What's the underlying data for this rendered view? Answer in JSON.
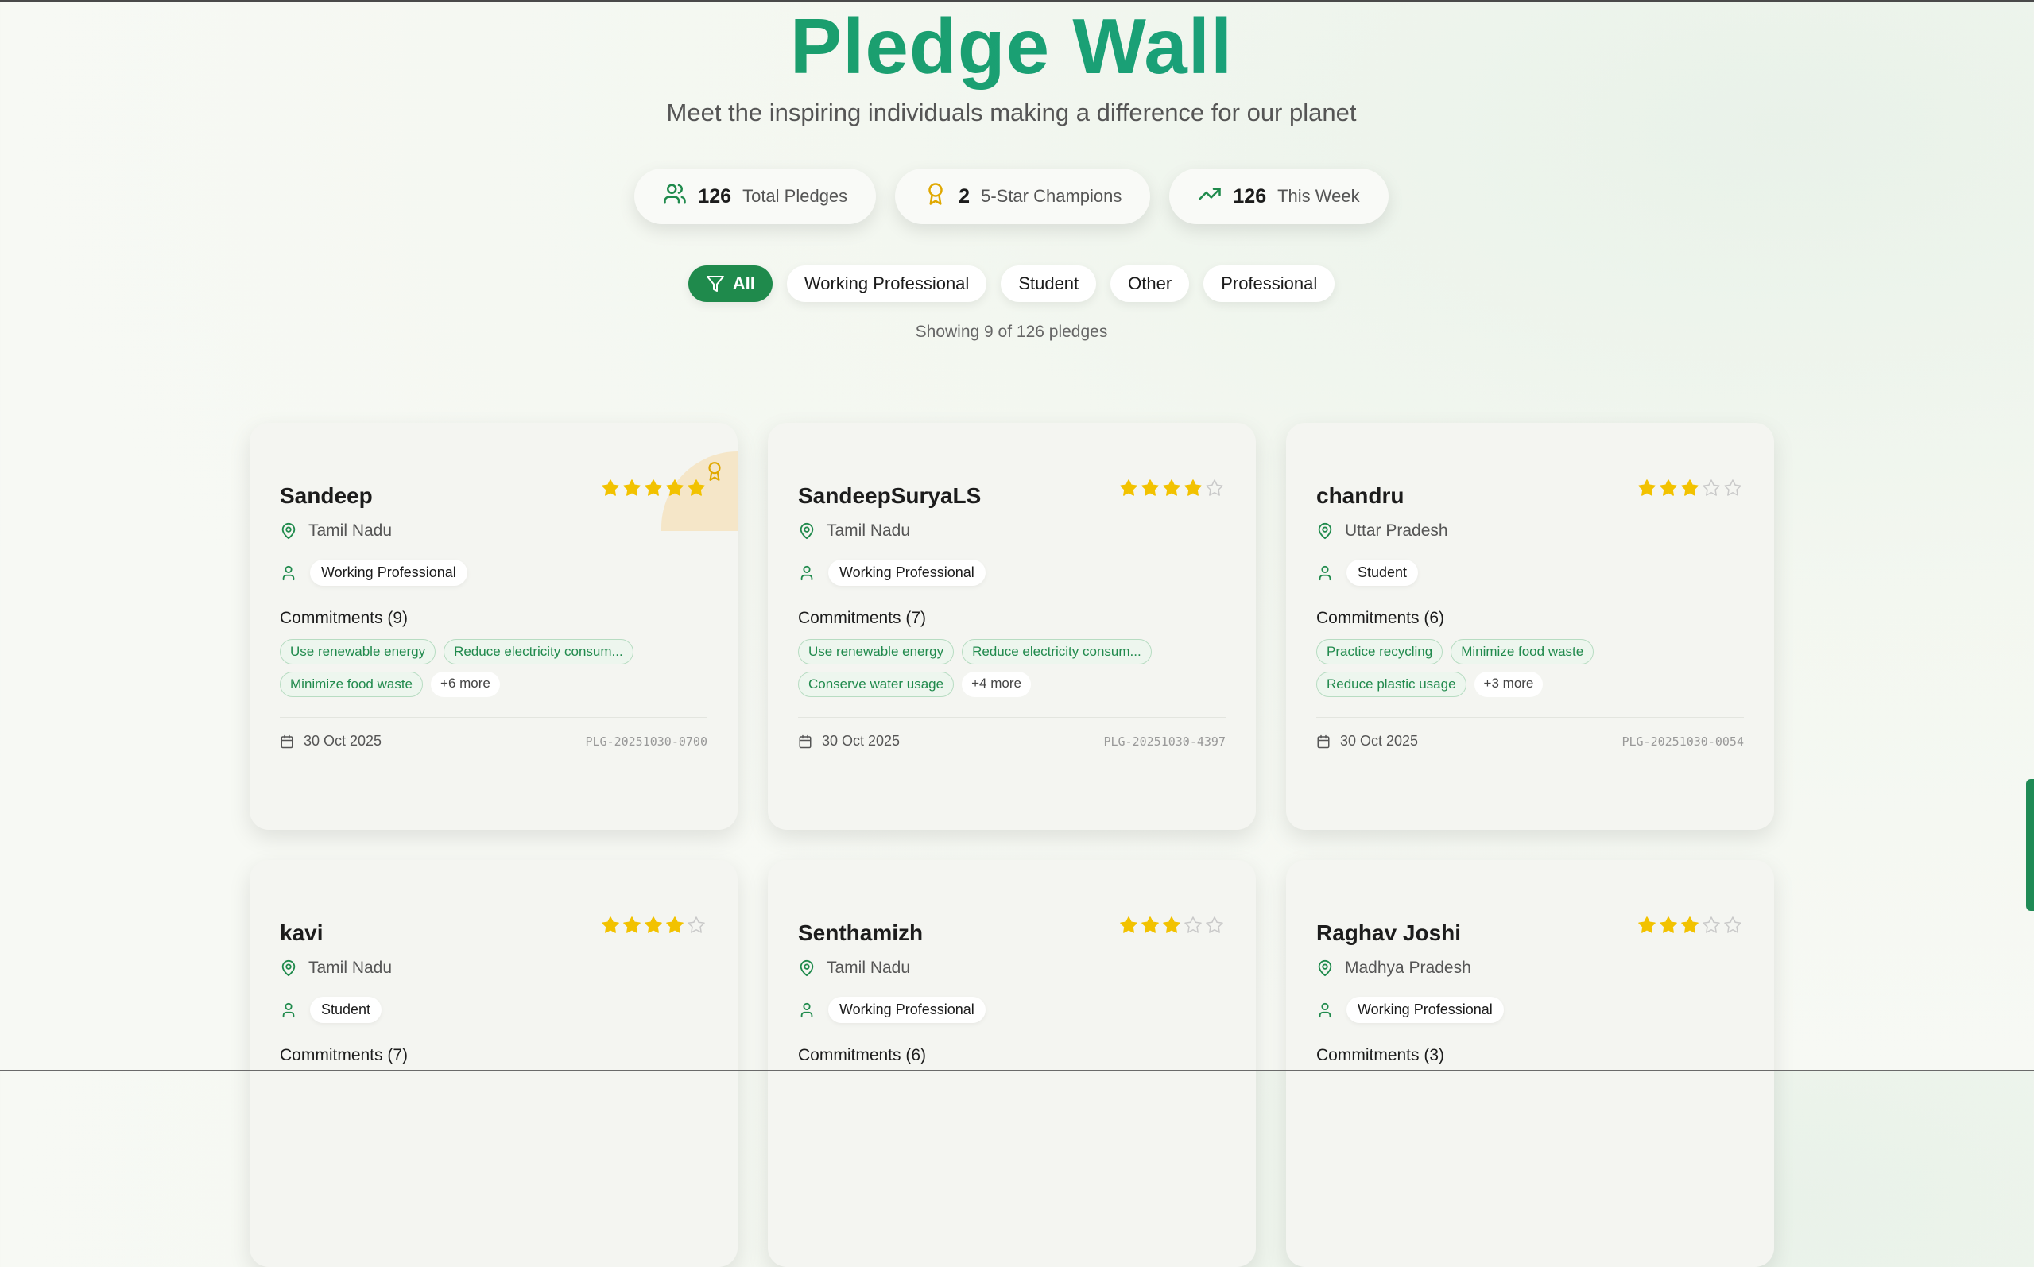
{
  "header": {
    "title": "Pledge Wall",
    "subtitle": "Meet the inspiring individuals making a difference for our planet"
  },
  "stats": [
    {
      "icon": "users-icon",
      "value": "126",
      "label": "Total Pledges"
    },
    {
      "icon": "award-icon",
      "value": "2",
      "label": "5-Star Champions"
    },
    {
      "icon": "trending-up-icon",
      "value": "126",
      "label": "This Week"
    }
  ],
  "filters": [
    {
      "label": "All",
      "active": true,
      "icon": "filter-icon"
    },
    {
      "label": "Working Professional",
      "active": false
    },
    {
      "label": "Student",
      "active": false
    },
    {
      "label": "Other",
      "active": false
    },
    {
      "label": "Professional",
      "active": false
    }
  ],
  "showing_text": "Showing 9 of 126 pledges",
  "colors": {
    "accent": "#1f8a4c",
    "star": "#f2c200",
    "star_empty": "#c9c9c9",
    "tag_text": "#218a4d"
  },
  "cards": [
    {
      "name": "Sandeep",
      "rating": 5,
      "champion": true,
      "location": "Tamil Nadu",
      "category": "Working Professional",
      "commitments_title": "Commitments (9)",
      "tags": [
        "Use renewable energy",
        "Reduce electricity consum...",
        "Minimize food waste"
      ],
      "more": "+6 more",
      "date": "30 Oct 2025",
      "pledge_id": "PLG-20251030-0700"
    },
    {
      "name": "SandeepSuryaLS",
      "rating": 4,
      "champion": false,
      "location": "Tamil Nadu",
      "category": "Working Professional",
      "commitments_title": "Commitments (7)",
      "tags": [
        "Use renewable energy",
        "Reduce electricity consum...",
        "Conserve water usage"
      ],
      "more": "+4 more",
      "date": "30 Oct 2025",
      "pledge_id": "PLG-20251030-4397"
    },
    {
      "name": "chandru",
      "rating": 3,
      "champion": false,
      "location": "Uttar Pradesh",
      "category": "Student",
      "commitments_title": "Commitments (6)",
      "tags": [
        "Practice recycling",
        "Minimize food waste",
        "Reduce plastic usage"
      ],
      "more": "+3 more",
      "date": "30 Oct 2025",
      "pledge_id": "PLG-20251030-0054"
    },
    {
      "name": "kavi",
      "rating": 4,
      "champion": false,
      "location": "Tamil Nadu",
      "category": "Student",
      "commitments_title": "Commitments (7)"
    },
    {
      "name": "Senthamizh",
      "rating": 3,
      "champion": false,
      "location": "Tamil Nadu",
      "category": "Working Professional",
      "commitments_title": "Commitments (6)"
    },
    {
      "name": "Raghav Joshi",
      "rating": 3,
      "champion": false,
      "location": "Madhya Pradesh",
      "category": "Working Professional",
      "commitments_title": "Commitments (3)"
    }
  ]
}
